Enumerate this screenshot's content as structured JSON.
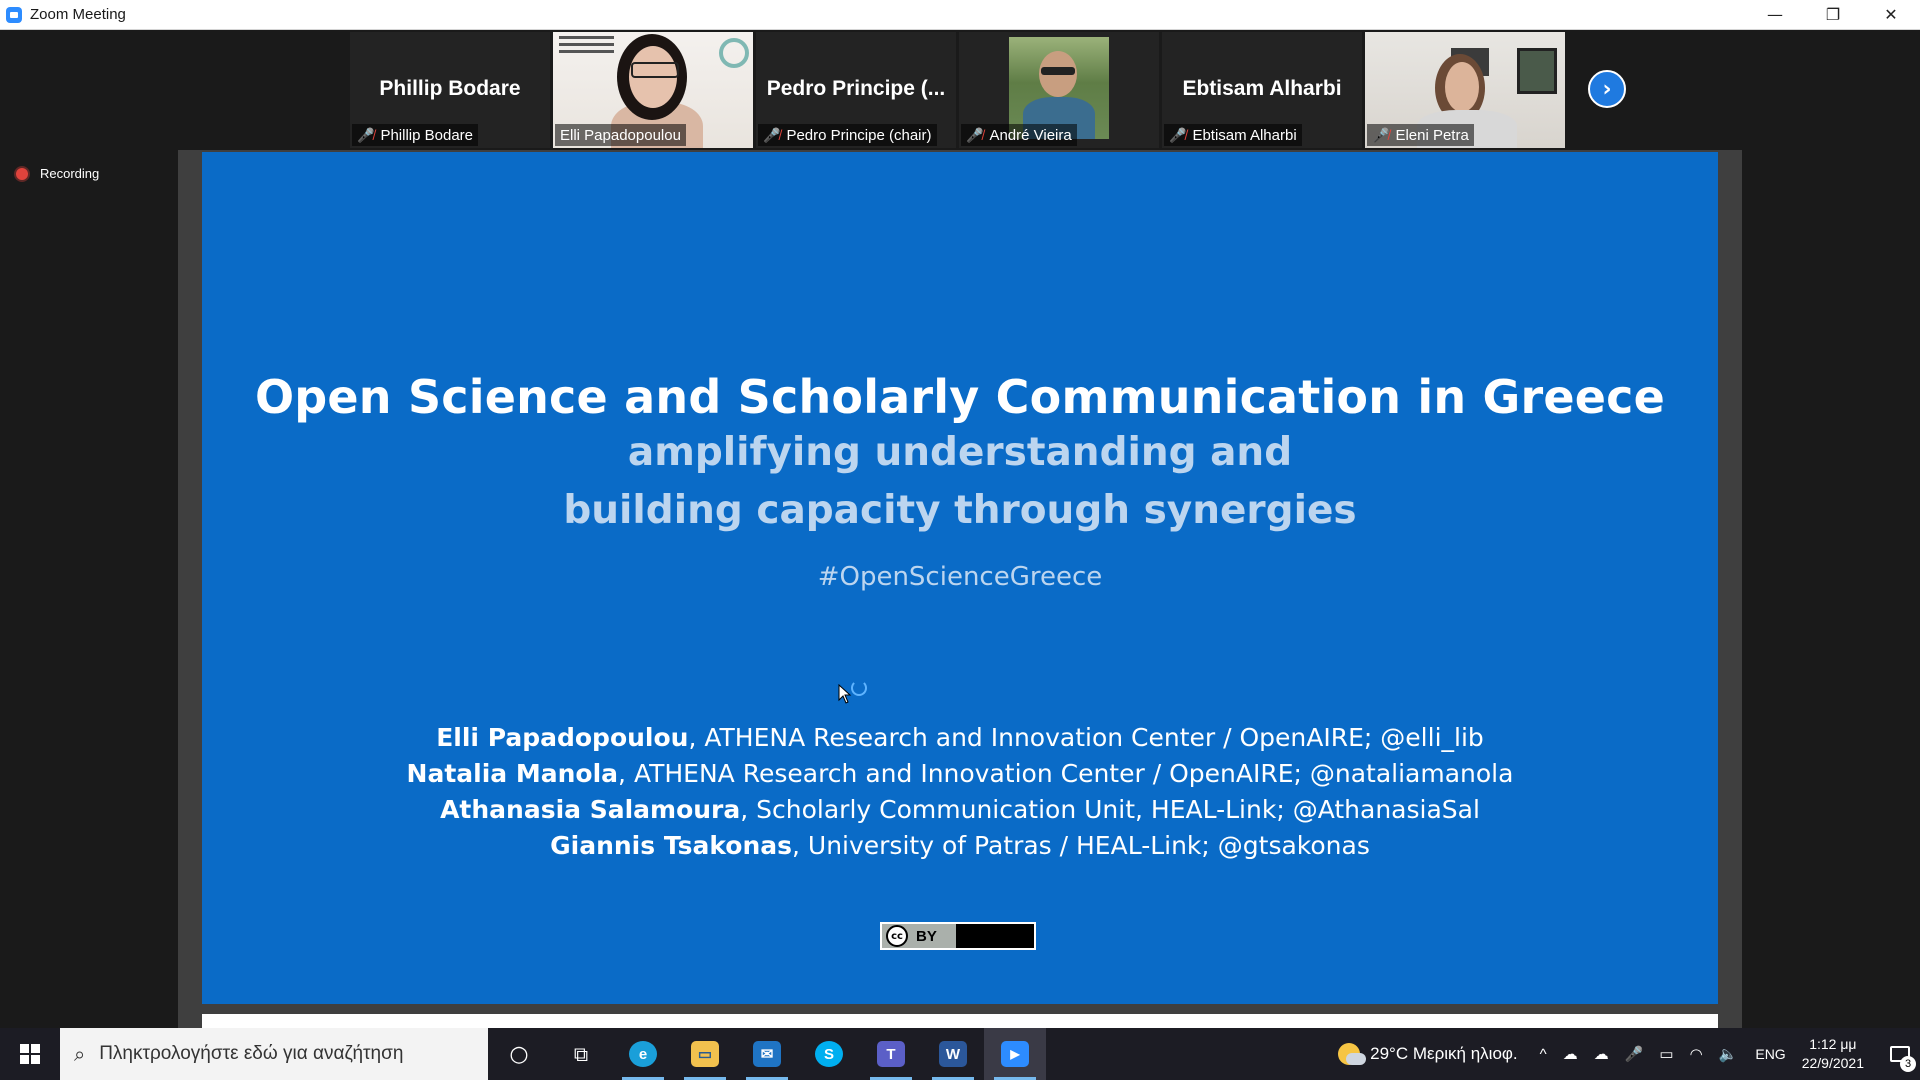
{
  "window": {
    "title": "Zoom Meeting",
    "controls": [
      "—",
      "❐",
      "✕"
    ]
  },
  "participants": [
    {
      "display": "Phillip Bodare",
      "label": "Phillip Bodare",
      "muted": true,
      "video": false
    },
    {
      "display": "",
      "label": "Elli Papadopoulou",
      "muted": false,
      "video": true,
      "active_speaker": true
    },
    {
      "display": "Pedro Principe (...",
      "label": "Pedro Principe (chair)",
      "muted": true,
      "video": false
    },
    {
      "display": "",
      "label": "André Vieira",
      "muted": true,
      "video": true
    },
    {
      "display": "Ebtisam Alharbi",
      "label": "Ebtisam Alharbi",
      "muted": true,
      "video": false
    },
    {
      "display": "",
      "label": "Eleni Petra",
      "muted": true,
      "video": true
    }
  ],
  "next_icon": "›",
  "recording_label": "Recording",
  "slide": {
    "title": "Open Science and Scholarly Communication in Greece",
    "subtitle_line1": "amplifying understanding and",
    "subtitle_line2": "building capacity through synergies",
    "hashtag": "#OpenScienceGreece",
    "authors": [
      {
        "name": "Elli Papadopoulou",
        "affiliation": ", ATHENA Research and Innovation Center / OpenAIRE; @elli_lib"
      },
      {
        "name": "Natalia Manola",
        "affiliation": ", ATHENA Research and Innovation Center / OpenAIRE; @nataliamanola"
      },
      {
        "name": "Athanasia Salamoura",
        "affiliation": ", Scholarly Communication Unit, HEAL-Link; @AthanasiaSal"
      },
      {
        "name": "Giannis Tsakonas",
        "affiliation": ", University of Patras / HEAL-Link; @gtsakonas"
      }
    ],
    "license": {
      "cc": "cc",
      "by": "BY"
    }
  },
  "taskbar": {
    "search_placeholder": "Πληκτρολογήστε εδώ για αναζήτηση",
    "apps": [
      {
        "name": "cortana",
        "glyph": "○"
      },
      {
        "name": "task-view",
        "glyph": "⧉"
      },
      {
        "name": "edge",
        "glyph": "e",
        "color": "#1a9fd9"
      },
      {
        "name": "file-explorer",
        "glyph": "▭",
        "color": "#f2c14e"
      },
      {
        "name": "mail",
        "glyph": "✉",
        "color": "#1f74c4"
      },
      {
        "name": "skype",
        "glyph": "S",
        "color": "#00aff0"
      },
      {
        "name": "teams",
        "glyph": "T",
        "color": "#5b5fc7"
      },
      {
        "name": "word",
        "glyph": "W",
        "color": "#2b579a"
      },
      {
        "name": "zoom",
        "glyph": "▶",
        "color": "#2d8cff"
      }
    ],
    "weather": "29°C  Μερική ηλιοφ.",
    "tray_symbols": [
      "^",
      "☁",
      "☁",
      "🎤",
      "▭",
      "◠",
      "🔈"
    ],
    "language": "ENG",
    "time": "1:12 μμ",
    "date": "22/9/2021",
    "notifications": "3"
  }
}
